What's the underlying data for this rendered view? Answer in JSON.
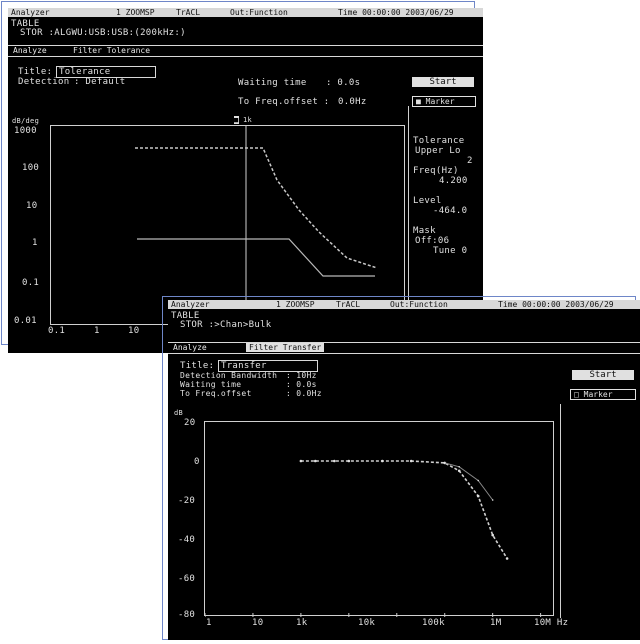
{
  "screen1": {
    "topbar": {
      "analyzer": "Analyzer",
      "mode": "1  ZOOMSP",
      "sample": "TrACL",
      "output": "Out:Function",
      "time": "Time 00:00:00 2003/06/29"
    },
    "status_label": "TABLE",
    "status_line": "STOR :ALGWU:USB:USB:(200kHz:)",
    "tabs": [
      "Analyze",
      "Filter Tolerance"
    ],
    "title_label": "Title:",
    "title_value": "Tolerance",
    "detection_label": "Detection",
    "detection_value": ": Default",
    "waiting_label": "Waiting time",
    "waiting_value": ": 0.0s",
    "offset_label": "To Freq.offset :",
    "offset_value": "0.0Hz",
    "start_button": "Start",
    "marker_button": "Marker",
    "cursor_label": "1k",
    "y_unit": "dB/deg",
    "y_ticks": [
      "1000",
      "100",
      "10",
      "1",
      "0.1",
      "0.01"
    ],
    "x_ticks": [
      "0.1",
      "1",
      "10"
    ],
    "side_items": [
      "Tolerance",
      "Upper Lo",
      "2",
      "Freq(Hz)",
      "4.200",
      "Level",
      "-464.0",
      "Mask",
      "Off:06",
      "Tune 0"
    ]
  },
  "screen2": {
    "topbar": {
      "analyzer": "Analyzer",
      "mode": "1  ZOOMSP",
      "sample": "TrACL",
      "output": "Out:Function",
      "time": "Time 00:00:00 2003/06/29"
    },
    "status_label": "TABLE",
    "status_line": "STOR :>Chan>Bulk",
    "tabs": [
      "Analyze",
      "Filter Transfer"
    ],
    "title_label": "Title:",
    "title_value": "Transfer",
    "rows": [
      {
        "label": "Detection Bandwidth",
        "value": ":  10Hz"
      },
      {
        "label": "Waiting time",
        "value": ":  0.0s"
      },
      {
        "label": "To Freq.offset",
        "value": ":  0.0Hz"
      }
    ],
    "start_button": "Start",
    "marker_button": "Marker",
    "y_unit": "dB",
    "y_ticks": [
      "20",
      "0",
      "-20",
      "-40",
      "-60",
      "-80"
    ],
    "x_ticks": [
      "1",
      "10",
      "1k",
      "10k",
      "100k",
      "1M",
      "10M Hz"
    ],
    "chart_data": {
      "type": "line",
      "xlabel": "Hz",
      "ylabel": "dB",
      "x_scale": "log",
      "ylim": [
        -80,
        20
      ],
      "series": [
        {
          "x": [
            100,
            200,
            500,
            1000,
            5000,
            20000,
            100000,
            200000,
            500000,
            1000000,
            2000000
          ],
          "values": [
            0,
            0,
            0,
            0,
            0,
            0,
            -1,
            -5,
            -18,
            -38,
            -50
          ]
        },
        {
          "x": [
            100000,
            200000,
            500000,
            1000000
          ],
          "values": [
            -1,
            -3,
            -10,
            -20
          ]
        }
      ]
    }
  },
  "colors": {
    "screen_bg": "#000000",
    "text": "#e0e0e0",
    "trace": "#d0d0d0",
    "frame": "#6e86c8"
  }
}
